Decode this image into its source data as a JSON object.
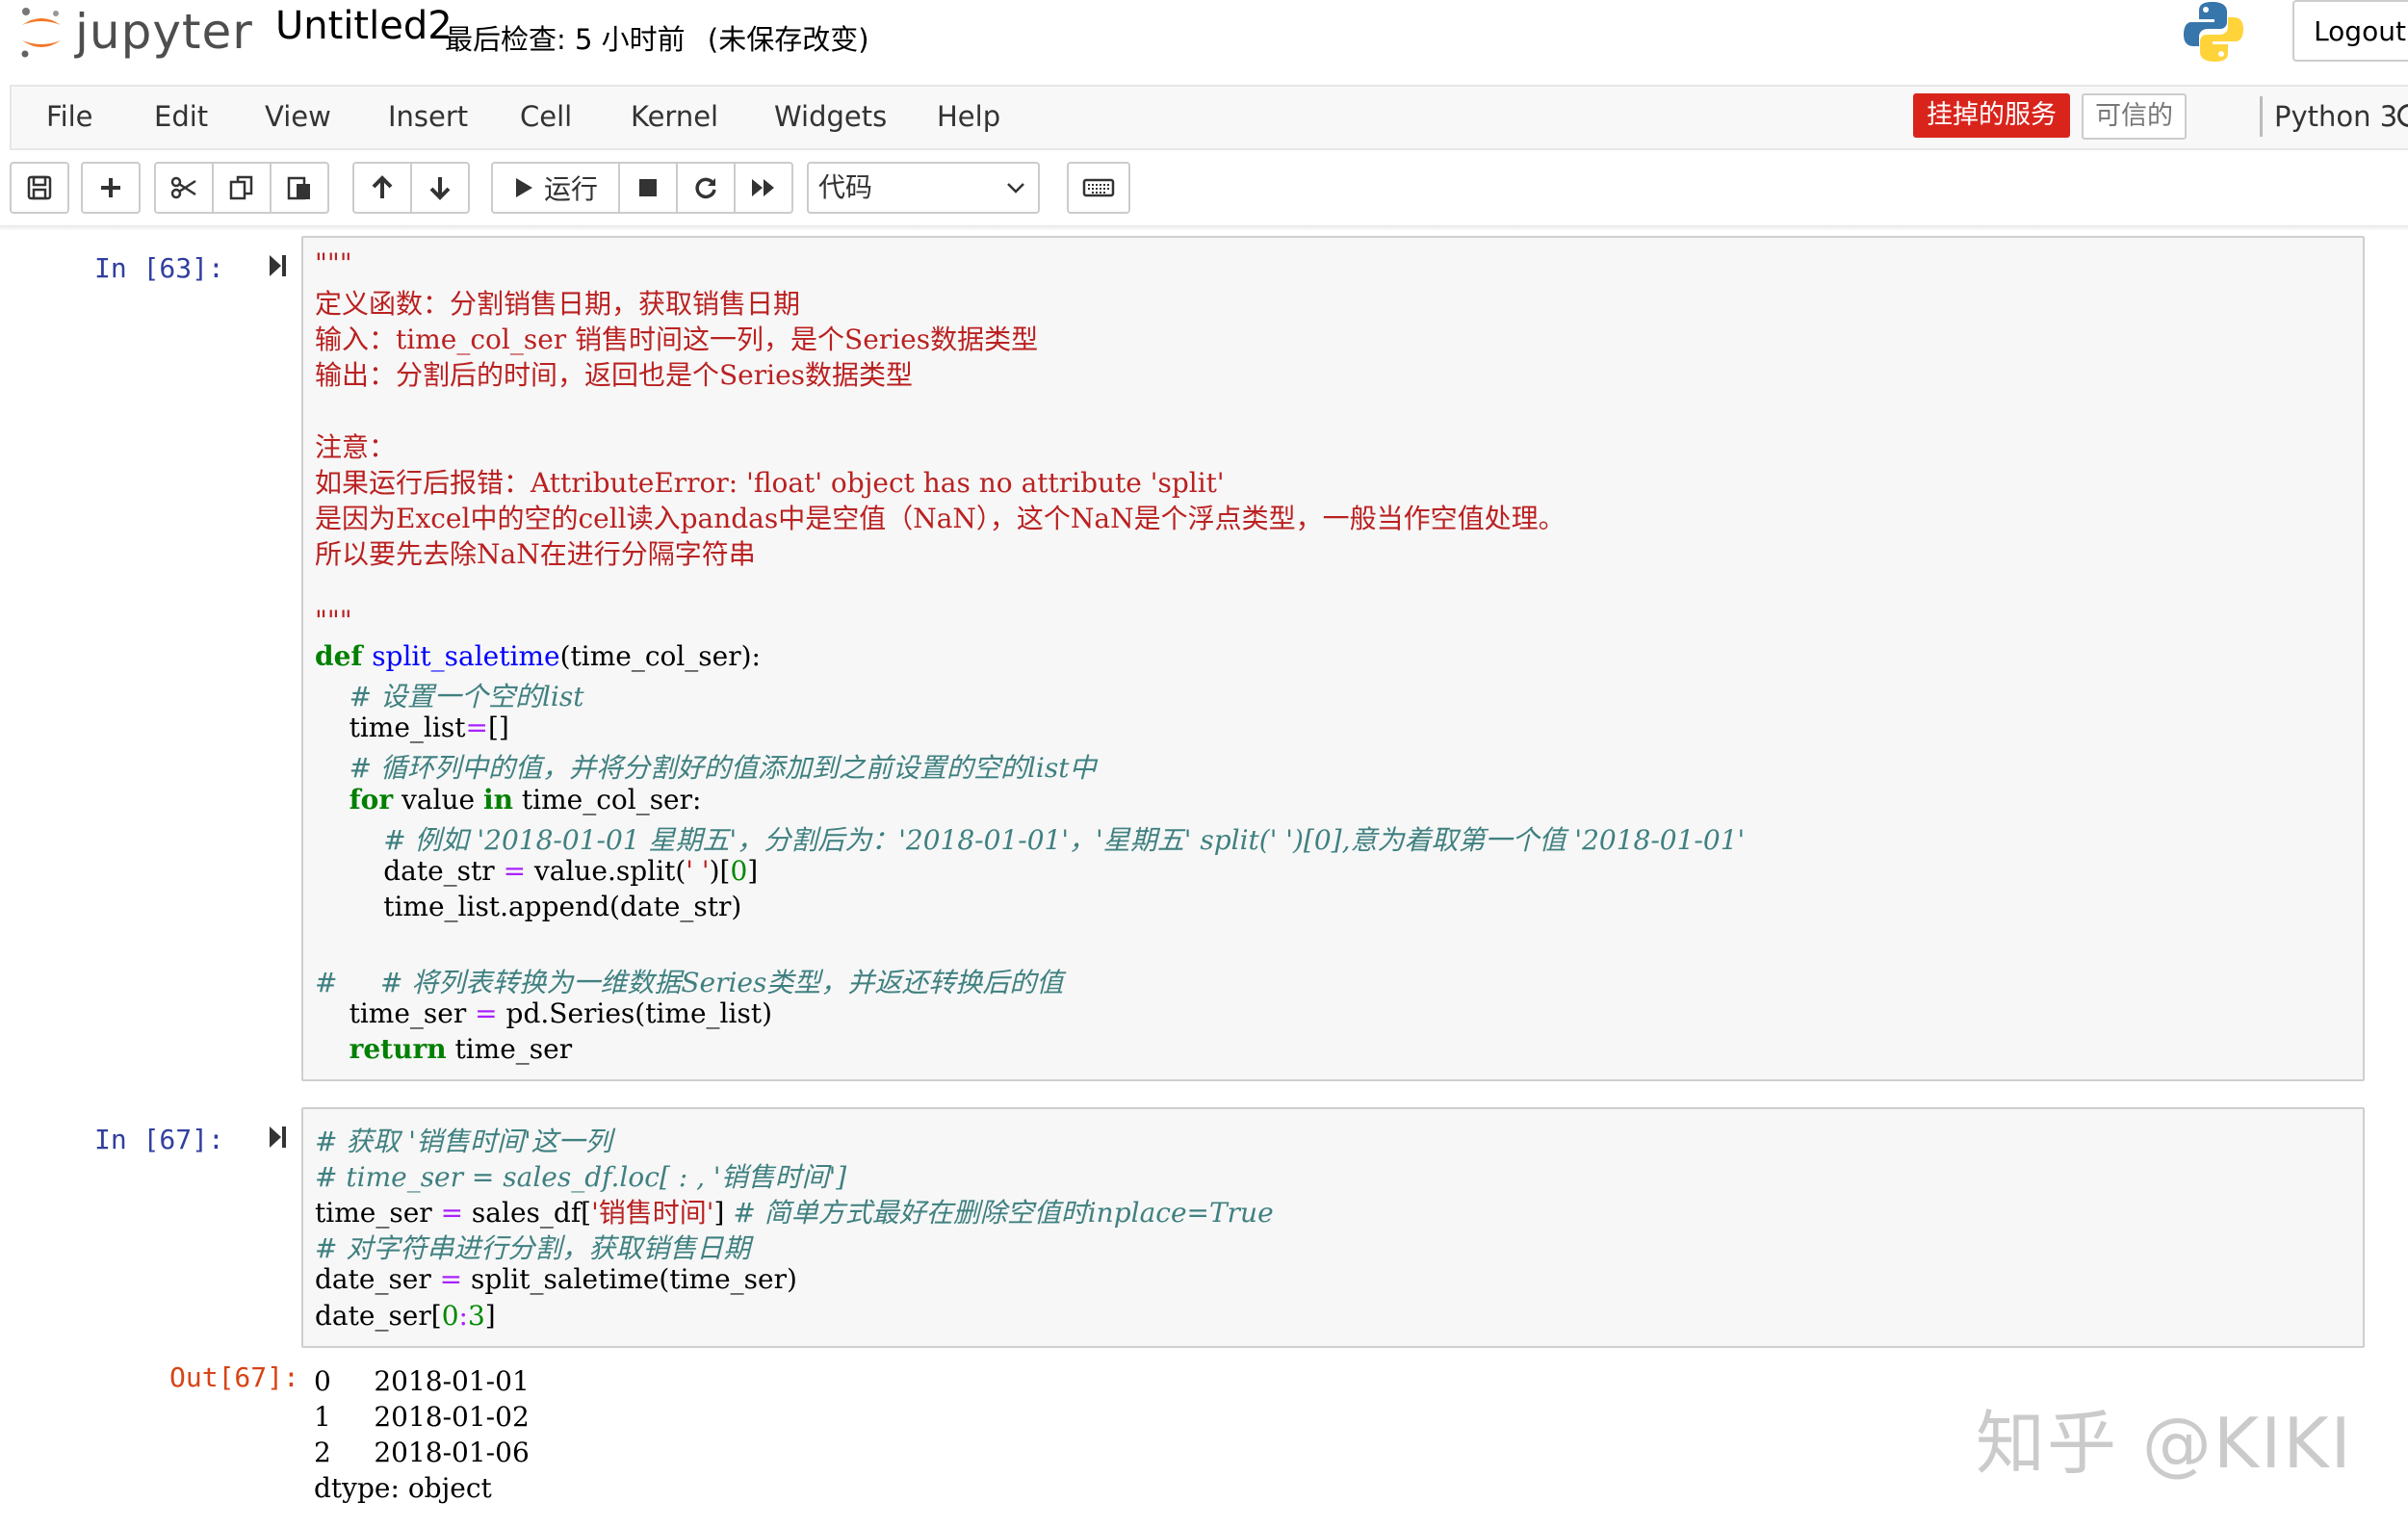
{
  "header": {
    "logo_text": "jupyter",
    "notebook_name": "Untitled2",
    "checkpoint": "最后检查: 5 小时前",
    "unsaved": "(未保存改变)",
    "logout_label": "Logout"
  },
  "menubar": {
    "items": [
      "File",
      "Edit",
      "View",
      "Insert",
      "Cell",
      "Kernel",
      "Widgets",
      "Help"
    ],
    "kernel_status": "挂掉的服务",
    "trusted": "可信的",
    "kernel_name": "Python 3"
  },
  "toolbar": {
    "run_label": "运行",
    "cell_type": "代码"
  },
  "cells": [
    {
      "prompt": "In  [63]:",
      "lines": [
        [
          [
            "c-doc",
            "\"\"\""
          ]
        ],
        [
          [
            "c-doc",
            "定义函数：分割销售日期，获取销售日期"
          ]
        ],
        [
          [
            "c-doc",
            "输入：time_col_ser 销售时间这一列，是个Series数据类型"
          ]
        ],
        [
          [
            "c-doc",
            "输出：分割后的时间，返回也是个Series数据类型"
          ]
        ],
        [
          [
            "c-doc",
            ""
          ]
        ],
        [
          [
            "c-doc",
            "注意："
          ]
        ],
        [
          [
            "c-doc",
            "如果运行后报错：AttributeError: 'float' object has no attribute 'split'"
          ]
        ],
        [
          [
            "c-doc",
            "是因为Excel中的空的cell读入pandas中是空值（NaN），这个NaN是个浮点类型，一般当作空值处理。"
          ]
        ],
        [
          [
            "c-doc",
            "所以要先去除NaN在进行分隔字符串"
          ]
        ],
        [
          [
            "c-doc",
            ""
          ]
        ],
        [
          [
            "c-doc",
            "\"\"\""
          ]
        ],
        [
          [
            "c-kw",
            "def "
          ],
          [
            "c-fn",
            "split_saletime"
          ],
          [
            "c-pl",
            "(time_col_ser):"
          ]
        ],
        [
          [
            "c-pl",
            "    "
          ],
          [
            "c-cm",
            "# 设置一个空的list"
          ]
        ],
        [
          [
            "c-pl",
            "    time_list"
          ],
          [
            "c-op",
            "="
          ],
          [
            "c-pl",
            "[]"
          ]
        ],
        [
          [
            "c-pl",
            "    "
          ],
          [
            "c-cm",
            "# 循环列中的值，并将分割好的值添加到之前设置的空的list中"
          ]
        ],
        [
          [
            "c-pl",
            "    "
          ],
          [
            "c-kw",
            "for"
          ],
          [
            "c-pl",
            " value "
          ],
          [
            "c-kw",
            "in"
          ],
          [
            "c-pl",
            " time_col_ser:"
          ]
        ],
        [
          [
            "c-pl",
            "        "
          ],
          [
            "c-cm",
            "# 例如 '2018-01-01 星期五'，分割后为：'2018-01-01'，'星期五' split(' ')[0],意为着取第一个值 '2018-01-01'"
          ]
        ],
        [
          [
            "c-pl",
            "        date_str "
          ],
          [
            "c-op",
            "="
          ],
          [
            "c-pl",
            " value.split("
          ],
          [
            "c-st",
            "' '"
          ],
          [
            "c-pl",
            ")["
          ],
          [
            "c-nm",
            "0"
          ],
          [
            "c-pl",
            "]"
          ]
        ],
        [
          [
            "c-pl",
            "        time_list.append(date_str)"
          ]
        ],
        [
          [
            "c-pl",
            ""
          ]
        ],
        [
          [
            "c-cm",
            "#     # 将列表转换为一维数据Series类型，并返还转换后的值"
          ]
        ],
        [
          [
            "c-pl",
            "    time_ser "
          ],
          [
            "c-op",
            "="
          ],
          [
            "c-pl",
            " pd.Series(time_list)"
          ]
        ],
        [
          [
            "c-pl",
            "    "
          ],
          [
            "c-kw",
            "return"
          ],
          [
            "c-pl",
            " time_ser"
          ]
        ]
      ]
    },
    {
      "prompt": "In  [67]:",
      "lines": [
        [
          [
            "c-cm",
            "# 获取 '销售时间'这一列"
          ]
        ],
        [
          [
            "c-cm",
            "# time_ser = sales_df.loc[ : , '销售时间']"
          ]
        ],
        [
          [
            "c-pl",
            "time_ser "
          ],
          [
            "c-op",
            "="
          ],
          [
            "c-pl",
            " sales_df["
          ],
          [
            "c-st",
            "'销售时间'"
          ],
          [
            "c-pl",
            "] "
          ],
          [
            "c-cm",
            "# 简单方式最好在删除空值时inplace=True"
          ]
        ],
        [
          [
            "c-cm",
            "# 对字符串进行分割，获取销售日期"
          ]
        ],
        [
          [
            "c-pl",
            "date_ser "
          ],
          [
            "c-op",
            "="
          ],
          [
            "c-pl",
            " split_saletime(time_ser)"
          ]
        ],
        [
          [
            "c-pl",
            "date_ser["
          ],
          [
            "c-nm",
            "0"
          ],
          [
            "c-op",
            ":"
          ],
          [
            "c-nm",
            "3"
          ],
          [
            "c-pl",
            "]"
          ]
        ]
      ],
      "output_prompt": "Out[67]:",
      "output_lines": [
        "0     2018-01-01",
        "1     2018-01-02",
        "2     2018-01-06",
        "dtype: object"
      ]
    }
  ],
  "watermark": "知乎 @KIKI"
}
